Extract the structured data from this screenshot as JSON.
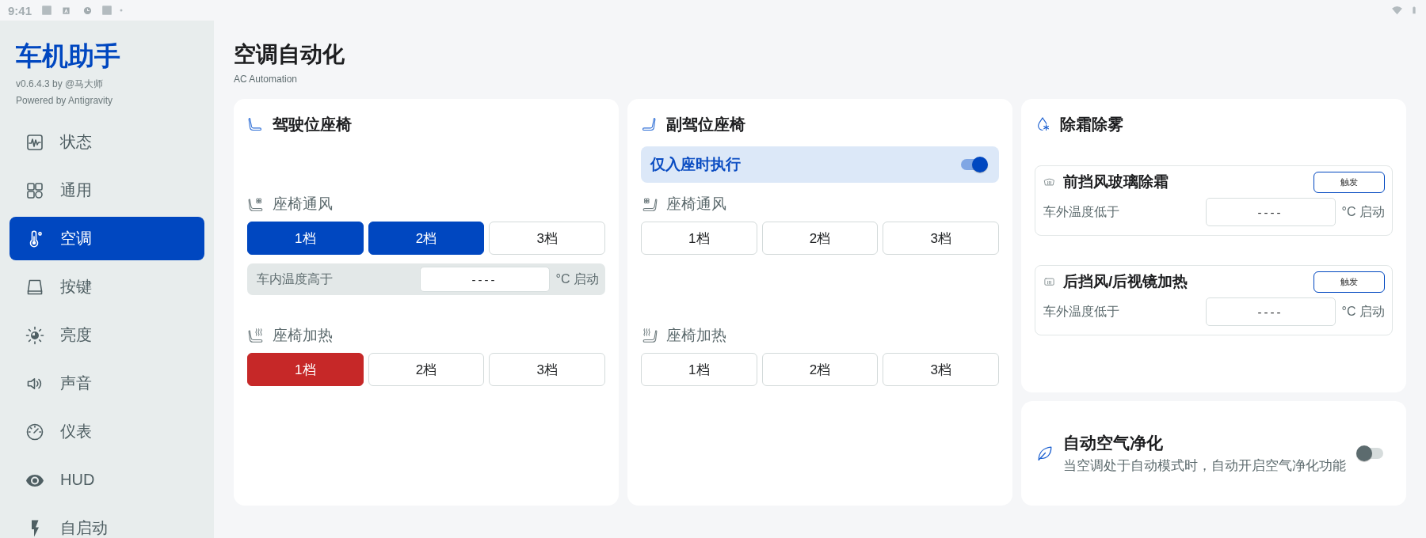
{
  "status_bar": {
    "time": "9:41"
  },
  "sidebar": {
    "title": "车机助手",
    "version": "v0.6.4.3 by @马大师",
    "powered_by": "Powered by Antigravity",
    "items": [
      {
        "label": "状态",
        "selected": false
      },
      {
        "label": "通用",
        "selected": false
      },
      {
        "label": "空调",
        "selected": true
      },
      {
        "label": "按键",
        "selected": false
      },
      {
        "label": "亮度",
        "selected": false
      },
      {
        "label": "声音",
        "selected": false
      },
      {
        "label": "仪表",
        "selected": false
      },
      {
        "label": "HUD",
        "selected": false
      },
      {
        "label": "自启动",
        "selected": false
      }
    ]
  },
  "header": {
    "title": "空调自动化",
    "subtitle": "AC Automation"
  },
  "seat_cards": [
    {
      "title": "驾驶位座椅",
      "sections": [
        {
          "kind": "ventilation",
          "label": "座椅通风",
          "levels": [
            {
              "label": "1档",
              "selected": true
            },
            {
              "label": "2档",
              "selected": true
            },
            {
              "label": "3档",
              "selected": false
            }
          ],
          "threshold": {
            "label": "车内温度高于",
            "placeholder": "----",
            "unit": "°C 启动"
          }
        },
        {
          "kind": "heating",
          "label": "座椅加热",
          "levels": [
            {
              "label": "1档",
              "selected": true
            },
            {
              "label": "2档",
              "selected": false
            },
            {
              "label": "3档",
              "selected": false
            }
          ]
        }
      ]
    },
    {
      "title": "副驾位座椅",
      "seat_only": {
        "label": "仅入座时执行",
        "on": true
      },
      "sections": [
        {
          "kind": "ventilation",
          "label": "座椅通风",
          "levels": [
            {
              "label": "1档",
              "selected": false
            },
            {
              "label": "2档",
              "selected": false
            },
            {
              "label": "3档",
              "selected": false
            }
          ]
        },
        {
          "kind": "heating",
          "label": "座椅加热",
          "levels": [
            {
              "label": "1档",
              "selected": false
            },
            {
              "label": "2档",
              "selected": false
            },
            {
              "label": "3档",
              "selected": false
            }
          ]
        }
      ]
    }
  ],
  "defrost_card": {
    "title": "除霜除雾",
    "items": [
      {
        "title": "前挡风玻璃除霜",
        "button": "触发",
        "label": "车外温度低于",
        "placeholder": "----",
        "unit": "°C 启动"
      },
      {
        "title": "后挡风/后视镜加热",
        "button": "触发",
        "label": "车外温度低于",
        "placeholder": "----",
        "unit": "°C 启动"
      }
    ]
  },
  "purify_card": {
    "title": "自动空气净化",
    "description": "当空调处于自动模式时，自动开启空气净化功能",
    "on": false
  }
}
